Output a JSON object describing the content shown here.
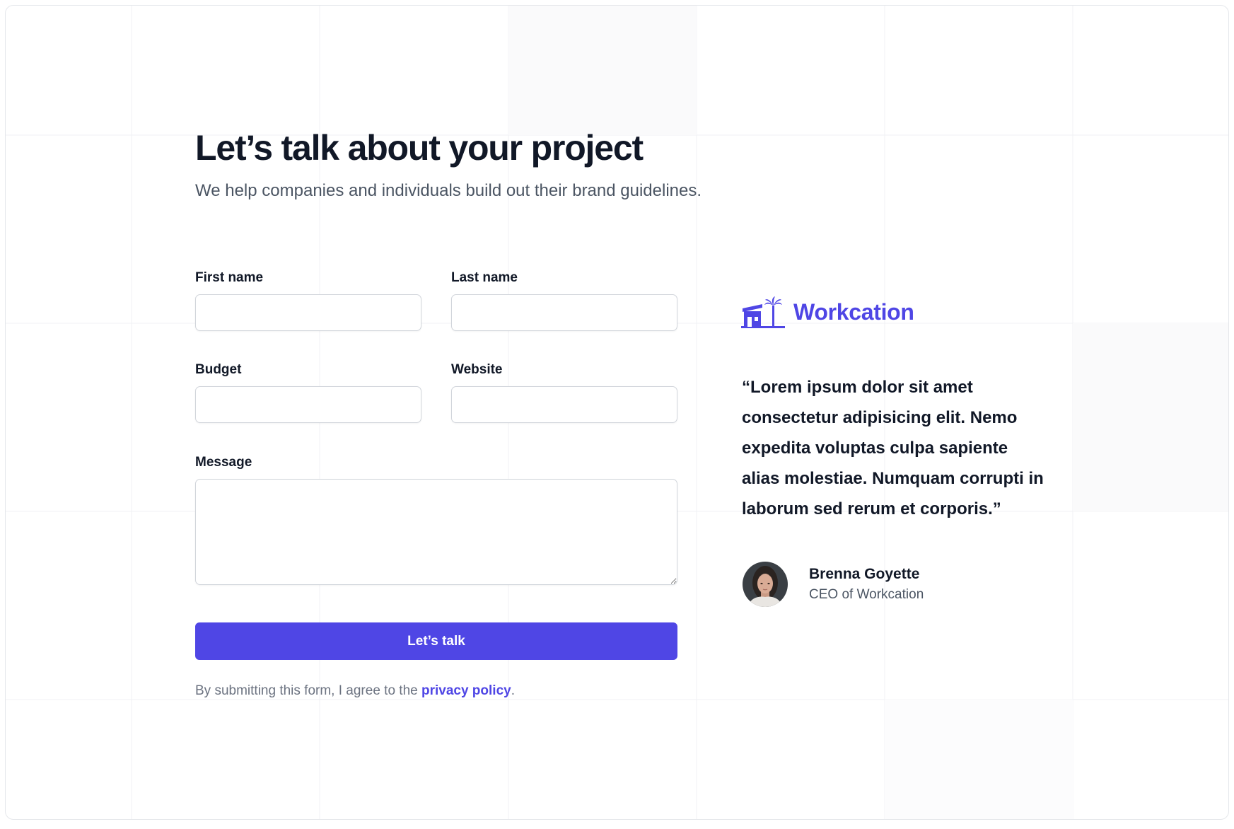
{
  "header": {
    "title": "Let’s talk about your project",
    "subtitle": "We help companies and individuals build out their brand guidelines."
  },
  "form": {
    "first_name_label": "First name",
    "last_name_label": "Last name",
    "budget_label": "Budget",
    "website_label": "Website",
    "message_label": "Message",
    "first_name_value": "",
    "last_name_value": "",
    "budget_value": "",
    "website_value": "",
    "message_value": "",
    "submit_label": "Let’s talk",
    "disclaimer_prefix": "By submitting this form, I agree to the",
    "disclaimer_link": "privacy policy",
    "disclaimer_suffix": "."
  },
  "testimonial": {
    "logo_icon": "house-palm-icon",
    "logo_text": "Workcation",
    "quote": "“Lorem ipsum dolor sit amet consectetur adipisicing elit. Nemo expedita voluptas culpa sapiente alias molestiae. Numquam corrupti in laborum sed rerum et corporis.”",
    "author_name": "Brenna Goyette",
    "author_role": "CEO of Workcation"
  },
  "colors": {
    "accent": "#4f46e5",
    "heading": "#111827",
    "muted": "#4b5563"
  }
}
